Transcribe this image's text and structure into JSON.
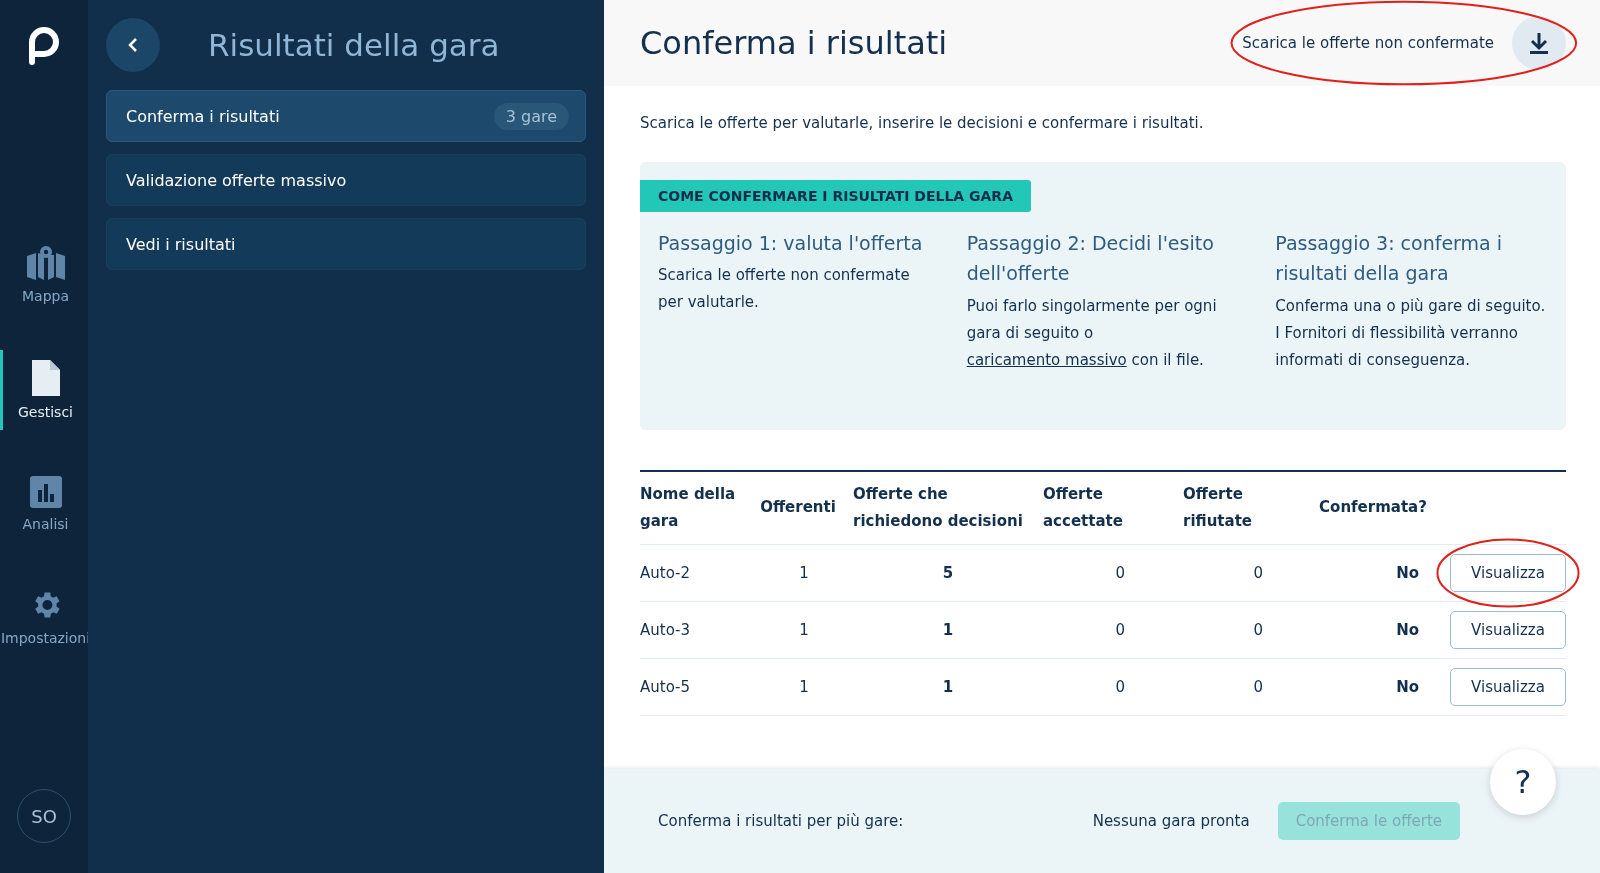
{
  "nav": {
    "items": [
      {
        "label": "Mappa",
        "selected": false
      },
      {
        "label": "Gestisci",
        "selected": true
      },
      {
        "label": "Analisi",
        "selected": false
      },
      {
        "label": "Impostazioni",
        "selected": false
      }
    ],
    "avatar": "SO"
  },
  "sidebar": {
    "title": "Risultati della gara",
    "items": [
      {
        "label": "Conferma i risultati",
        "badge": "3 gare",
        "selected": true
      },
      {
        "label": "Validazione offerte massivo",
        "selected": false
      },
      {
        "label": "Vedi i risultati",
        "selected": false
      }
    ]
  },
  "header": {
    "title": "Conferma i risultati",
    "download_label": "Scarica le offerte non confermate",
    "annotated": true
  },
  "intro": "Scarica le offerte per valutarle, inserire le decisioni e confermare i risultati.",
  "howto": {
    "tag": "COME CONFERMARE I RISULTATI DELLA GARA",
    "steps": [
      {
        "title": "Passaggio 1: valuta l'offerta",
        "text_before": "Scarica le offerte non confermate per valutarle."
      },
      {
        "title": "Passaggio 2: Decidi l'esito dell'offerte",
        "text_before": "Puoi farlo singolarmente per ogni gara di seguito o ",
        "link": "caricamento massivo",
        "text_after": " con il file."
      },
      {
        "title": "Passaggio 3: conferma i risultati della gara",
        "text_before": "Conferma una o più gare di seguito. I Fornitori di flessibilità verranno informati di conseguenza."
      }
    ]
  },
  "table": {
    "columns": [
      "Nome della gara",
      "Offerenti",
      "Offerte che richiedono decisioni",
      "Offerte accettate",
      "Offerte rifiutate",
      "Confermata?"
    ],
    "rows": [
      {
        "name": "Auto-2",
        "bidders": "1",
        "pending": "5",
        "accepted": "0",
        "rejected": "0",
        "confirmed": "No",
        "action": "Visualizza",
        "annotated": true
      },
      {
        "name": "Auto-3",
        "bidders": "1",
        "pending": "1",
        "accepted": "0",
        "rejected": "0",
        "confirmed": "No",
        "action": "Visualizza",
        "annotated": false
      },
      {
        "name": "Auto-5",
        "bidders": "1",
        "pending": "1",
        "accepted": "0",
        "rejected": "0",
        "confirmed": "No",
        "action": "Visualizza",
        "annotated": false
      }
    ]
  },
  "footer": {
    "label": "Conferma i risultati per più gare:",
    "status": "Nessuna gara pronta",
    "button": "Conferma le offerte",
    "button_disabled": true,
    "help": "?"
  }
}
